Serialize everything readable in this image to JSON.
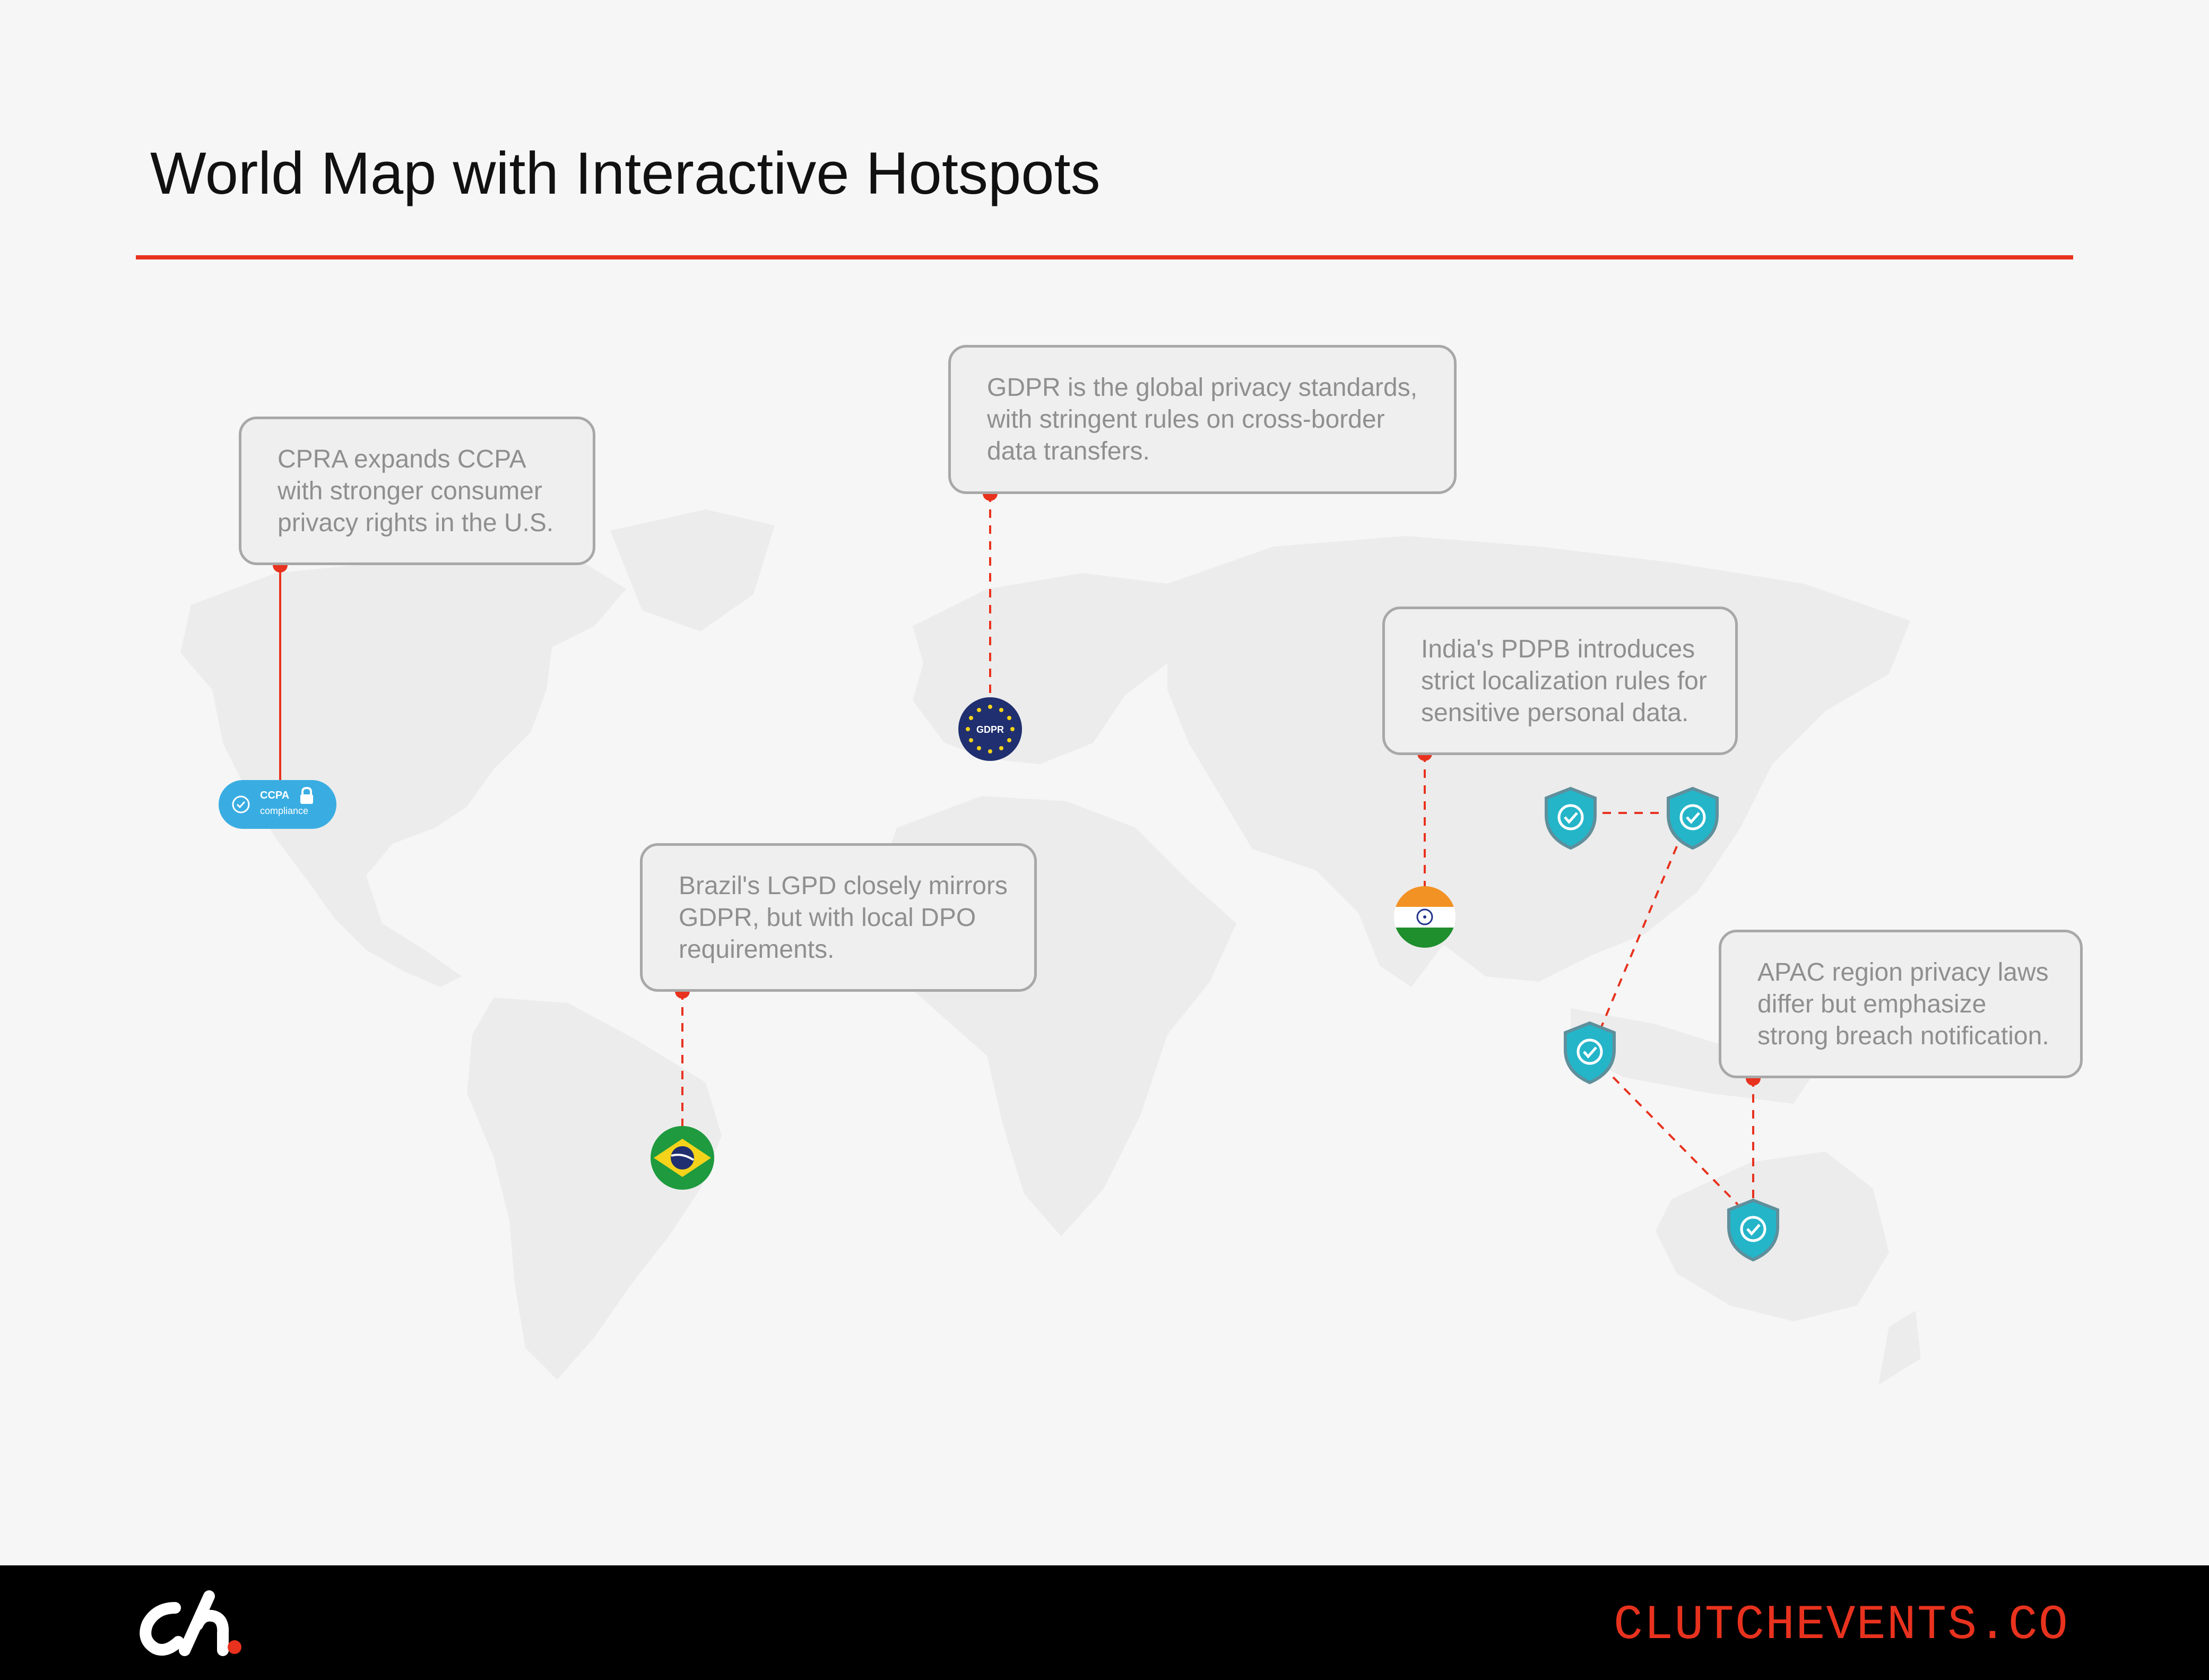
{
  "title": "World Map with Interactive Hotspots",
  "callouts": {
    "cpra": [
      "CPRA expands CCPA",
      "with stronger consumer",
      "privacy rights in the U.S."
    ],
    "gdpr": [
      "GDPR is the global privacy standards,",
      "with stringent rules on cross-border",
      "data transfers."
    ],
    "lgpd": [
      "Brazil's LGPD closely mirrors",
      "GDPR, but with local DPO",
      "requirements."
    ],
    "pdpb": [
      "India's PDPB introduces",
      "strict localization rules for",
      "sensitive personal data."
    ],
    "apac": [
      "APAC region privacy laws",
      "differ but emphasize",
      "strong breach notification."
    ]
  },
  "markers": {
    "ccpa_label": "CCPA",
    "ccpa_sub": "compliance",
    "gdpr_label": "GDPR"
  },
  "footer": {
    "site": "CLUTCHEVENTS.CO"
  },
  "colors": {
    "accent": "#e8321e",
    "shield": "#24b5c9",
    "ccpa": "#39ade2",
    "eu_blue": "#1f2f6f"
  }
}
